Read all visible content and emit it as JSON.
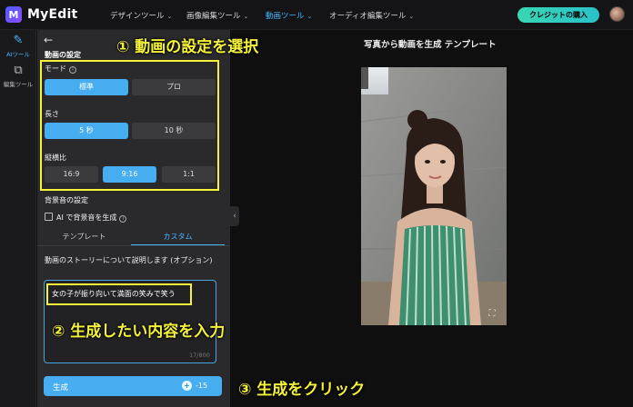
{
  "app": {
    "name": "MyEdit",
    "logo_letter": "M"
  },
  "nav": [
    {
      "label": "デザインツール",
      "active": false
    },
    {
      "label": "画像編集ツール",
      "active": false
    },
    {
      "label": "動画ツール",
      "active": true
    },
    {
      "label": "オーディオ編集ツール",
      "active": false
    }
  ],
  "header": {
    "buy_label": "クレジットの購入"
  },
  "rail": {
    "ai_tools": "AIツール",
    "edit_tools": "編集ツール"
  },
  "panel": {
    "section_video": "動画の設定",
    "mode_label": "モード",
    "mode_options": [
      "標準",
      "プロ"
    ],
    "mode_selected": "標準",
    "length_label": "長さ",
    "length_options": [
      "5 秒",
      "10 秒"
    ],
    "length_selected": "5 秒",
    "ratio_label": "縦横比",
    "ratio_options": [
      "16:9",
      "9:16",
      "1:1"
    ],
    "ratio_selected": "9:16",
    "section_bgm": "背景音の設定",
    "bgm_checkbox_label": "AI で背景音を生成",
    "tabs": [
      "テンプレート",
      "カスタム"
    ],
    "tab_active": "カスタム",
    "story_label": "動画のストーリーについて説明します (オプション)",
    "prompt_value": "女の子が振り向いて満面の笑みで笑う",
    "char_counter": "17/800",
    "generate_label": "生成",
    "generate_cost": "-15"
  },
  "preview": {
    "title": "写真から動画を生成 テンプレート"
  },
  "annotations": {
    "step1": "① 動画の設定を選択",
    "step2": "② 生成したい内容を入力",
    "step3": "③ 生成をクリック"
  },
  "colors": {
    "accent": "#46aef0",
    "annotation": "#f5f23a",
    "panel_bg": "#2a2a2d",
    "buy_gradient_start": "#38d6b4"
  }
}
